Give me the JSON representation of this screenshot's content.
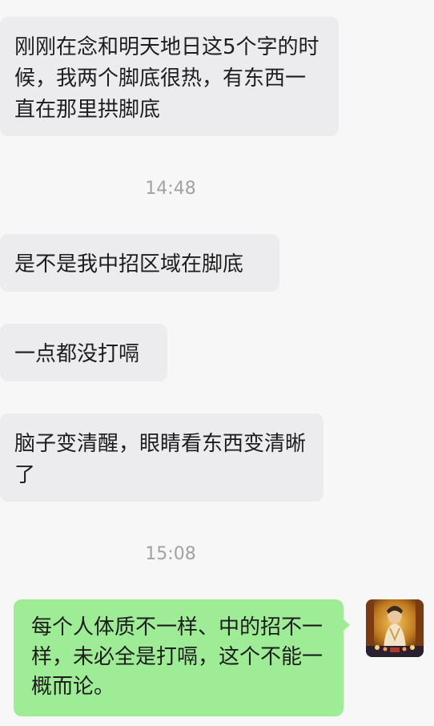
{
  "messages": [
    {
      "side": "incoming",
      "text": "刚刚在念和明天地日这5个字的时候，我两个脚底很热，有东西一直在那里拱脚底"
    },
    {
      "side": "timestamp",
      "text": "14:48"
    },
    {
      "side": "incoming",
      "text": "是不是我中招区域在脚底"
    },
    {
      "side": "incoming",
      "text": "一点都没打嗝"
    },
    {
      "side": "incoming",
      "text": "脑子变清醒，眼睛看东西变清晰了"
    },
    {
      "side": "timestamp",
      "text": "15:08"
    },
    {
      "side": "outgoing",
      "text": "每个人体质不一样、中的招不一样，未必全是打嗝，这个不能一概而论。"
    }
  ],
  "colors": {
    "background": "#f7f7f8",
    "incoming_bubble": "#ececee",
    "outgoing_bubble": "#9eec96",
    "timestamp_text": "#a2a2a6",
    "message_text": "#1d1d1d"
  },
  "avatar": {
    "icon": "self-avatar-icon"
  }
}
